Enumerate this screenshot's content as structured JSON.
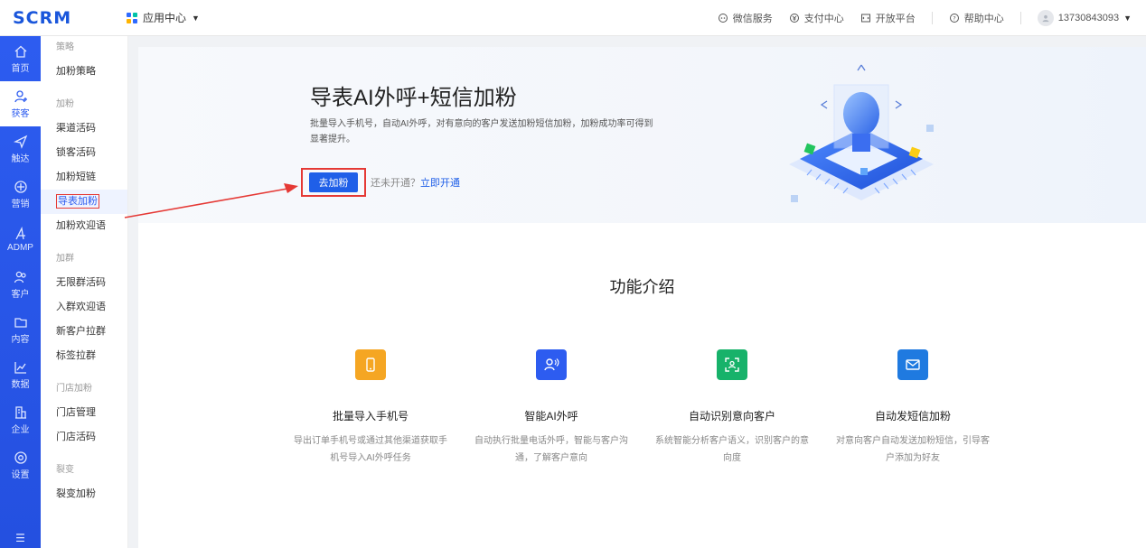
{
  "header": {
    "logo": "SCRM",
    "app_center": "应用中心",
    "links": [
      {
        "label": "微信服务",
        "icon": "wechat-service-icon"
      },
      {
        "label": "支付中心",
        "icon": "payment-icon"
      },
      {
        "label": "开放平台",
        "icon": "open-platform-icon"
      }
    ],
    "help": "帮助中心",
    "phone": "13730843093"
  },
  "rail": [
    {
      "label": "首页",
      "icon": "home-icon"
    },
    {
      "label": "获客",
      "icon": "add-user-icon"
    },
    {
      "label": "触达",
      "icon": "send-icon"
    },
    {
      "label": "营销",
      "icon": "marketing-icon"
    },
    {
      "label": "ADMP",
      "icon": "admp-icon"
    },
    {
      "label": "客户",
      "icon": "customers-icon"
    },
    {
      "label": "内容",
      "icon": "folder-icon"
    },
    {
      "label": "数据",
      "icon": "chart-icon"
    },
    {
      "label": "企业",
      "icon": "building-icon"
    },
    {
      "label": "设置",
      "icon": "settings-icon"
    }
  ],
  "submenu": {
    "group1": "策略",
    "item_strategy": "加粉策略",
    "group2": "加粉",
    "item_channel": "渠道活码",
    "item_lock": "锁客活码",
    "item_shortlink": "加粉短链",
    "item_import": "导表加粉",
    "item_welcome": "加粉欢迎语",
    "group3": "加群",
    "item_unlimited": "无限群活码",
    "item_group_welcome": "入群欢迎语",
    "item_new_customer": "新客户拉群",
    "item_tag": "标签拉群",
    "group4": "门店加粉",
    "item_store_mgmt": "门店管理",
    "item_store_code": "门店活码",
    "group5": "裂变",
    "item_fission": "裂变加粉"
  },
  "banner": {
    "title": "导表AI外呼+短信加粉",
    "desc": "批量导入手机号，自动AI外呼，对有意向的客户发送加粉短信加粉，加粉成功率可得到显著提升。",
    "button": "去加粉",
    "not_open": "还未开通？",
    "open_link": "立即开通"
  },
  "features_title": "功能介绍",
  "features": [
    {
      "title": "批量导入手机号",
      "desc": "导出订单手机号或通过其他渠道获取手机号导入AI外呼任务",
      "color": "#f5a623",
      "icon": "phone-icon"
    },
    {
      "title": "智能AI外呼",
      "desc": "自动执行批量电话外呼，智能与客户沟通，了解客户意向",
      "color": "#2d5cf0",
      "icon": "ai-call-icon"
    },
    {
      "title": "自动识别意向客户",
      "desc": "系统智能分析客户语义，识别客户的意向度",
      "color": "#17b26a",
      "icon": "scan-user-icon"
    },
    {
      "title": "自动发短信加粉",
      "desc": "对意向客户自动发送加粉短信，引导客户添加为好友",
      "color": "#1f7ae0",
      "icon": "mail-icon"
    }
  ]
}
